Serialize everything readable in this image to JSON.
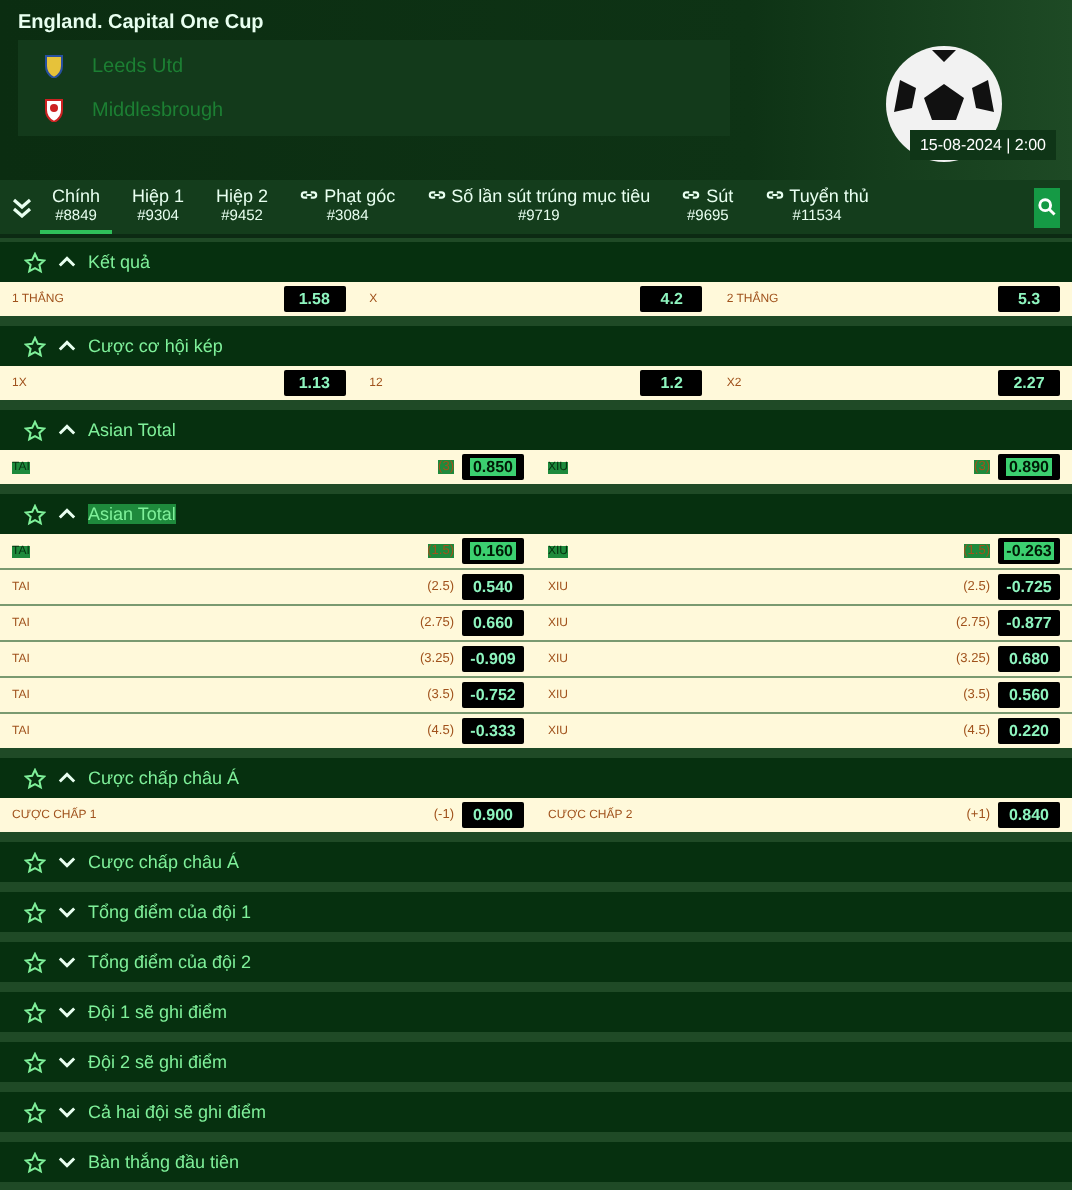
{
  "match": {
    "league": "England. Capital One Cup",
    "teams": [
      {
        "name": "Leeds Utd"
      },
      {
        "name": "Middlesbrough"
      }
    ],
    "datetime": "15-08-2024 | 2:00"
  },
  "tabs": [
    {
      "label": "Chính",
      "count": "#8849",
      "linked": false,
      "selected": true
    },
    {
      "label": "Hiệp 1",
      "count": "#9304",
      "linked": false,
      "selected": false
    },
    {
      "label": "Hiệp 2",
      "count": "#9452",
      "linked": false,
      "selected": false
    },
    {
      "label": "Phạt góc",
      "count": "#3084",
      "linked": true,
      "selected": false
    },
    {
      "label": "Số lần sút trúng mục tiêu",
      "count": "#9719",
      "linked": true,
      "selected": false
    },
    {
      "label": "Sút",
      "count": "#9695",
      "linked": true,
      "selected": false
    },
    {
      "label": "Tuyển thủ",
      "count": "#11534",
      "linked": true,
      "selected": false
    }
  ],
  "sections": [
    {
      "title": "Kết quả",
      "expanded": true,
      "highlighted": false,
      "rows": [
        {
          "highlighted": false,
          "cells": [
            {
              "label": "1 THẮNG",
              "odds": "1.58"
            },
            {
              "label": "X",
              "odds": "4.2"
            },
            {
              "label": "2 THẮNG",
              "odds": "5.3"
            }
          ]
        }
      ]
    },
    {
      "title": "Cược cơ hội kép",
      "expanded": true,
      "highlighted": false,
      "rows": [
        {
          "highlighted": false,
          "cells": [
            {
              "label": "1X",
              "odds": "1.13"
            },
            {
              "label": "12",
              "odds": "1.2"
            },
            {
              "label": "X2",
              "odds": "2.27"
            }
          ]
        }
      ]
    },
    {
      "title": "Asian Total",
      "expanded": true,
      "highlighted": false,
      "rows": [
        {
          "highlighted": true,
          "cells": [
            {
              "label": "TAI",
              "handicap": "(3)",
              "odds": "0.850"
            },
            {
              "label": "XIU",
              "handicap": "(3)",
              "odds": "0.890"
            }
          ]
        }
      ]
    },
    {
      "title": "Asian Total",
      "expanded": true,
      "highlighted": true,
      "rows": [
        {
          "highlighted": true,
          "cells": [
            {
              "label": "TAI",
              "handicap": "(1.5)",
              "odds": "0.160"
            },
            {
              "label": "XIU",
              "handicap": "(1.5)",
              "odds": "-0.263"
            }
          ]
        },
        {
          "highlighted": false,
          "cells": [
            {
              "label": "TAI",
              "handicap": "(2.5)",
              "odds": "0.540"
            },
            {
              "label": "XIU",
              "handicap": "(2.5)",
              "odds": "-0.725"
            }
          ]
        },
        {
          "highlighted": false,
          "cells": [
            {
              "label": "TAI",
              "handicap": "(2.75)",
              "odds": "0.660"
            },
            {
              "label": "XIU",
              "handicap": "(2.75)",
              "odds": "-0.877"
            }
          ]
        },
        {
          "highlighted": false,
          "cells": [
            {
              "label": "TAI",
              "handicap": "(3.25)",
              "odds": "-0.909"
            },
            {
              "label": "XIU",
              "handicap": "(3.25)",
              "odds": "0.680"
            }
          ]
        },
        {
          "highlighted": false,
          "cells": [
            {
              "label": "TAI",
              "handicap": "(3.5)",
              "odds": "-0.752"
            },
            {
              "label": "XIU",
              "handicap": "(3.5)",
              "odds": "0.560"
            }
          ]
        },
        {
          "highlighted": false,
          "cells": [
            {
              "label": "TAI",
              "handicap": "(4.5)",
              "odds": "-0.333"
            },
            {
              "label": "XIU",
              "handicap": "(4.5)",
              "odds": "0.220"
            }
          ]
        }
      ]
    },
    {
      "title": "Cược chấp châu Á",
      "expanded": true,
      "highlighted": false,
      "rows": [
        {
          "highlighted": false,
          "cells": [
            {
              "label": "CƯỢC CHẤP 1",
              "handicap": "(-1)",
              "odds": "0.900"
            },
            {
              "label": "CƯỢC CHẤP 2",
              "handicap": "(+1)",
              "odds": "0.840"
            }
          ]
        }
      ]
    },
    {
      "title": "Cược chấp châu Á",
      "expanded": false,
      "highlighted": false
    },
    {
      "title": "Tổng điểm của đội 1",
      "expanded": false,
      "highlighted": false
    },
    {
      "title": "Tổng điểm của đội 2",
      "expanded": false,
      "highlighted": false
    },
    {
      "title": "Đội 1 sẽ ghi điểm",
      "expanded": false,
      "highlighted": false
    },
    {
      "title": "Đội 2 sẽ ghi điểm",
      "expanded": false,
      "highlighted": false
    },
    {
      "title": "Cả hai đội sẽ ghi điểm",
      "expanded": false,
      "highlighted": false
    },
    {
      "title": "Bàn thắng đầu tiên",
      "expanded": false,
      "highlighted": false
    }
  ]
}
